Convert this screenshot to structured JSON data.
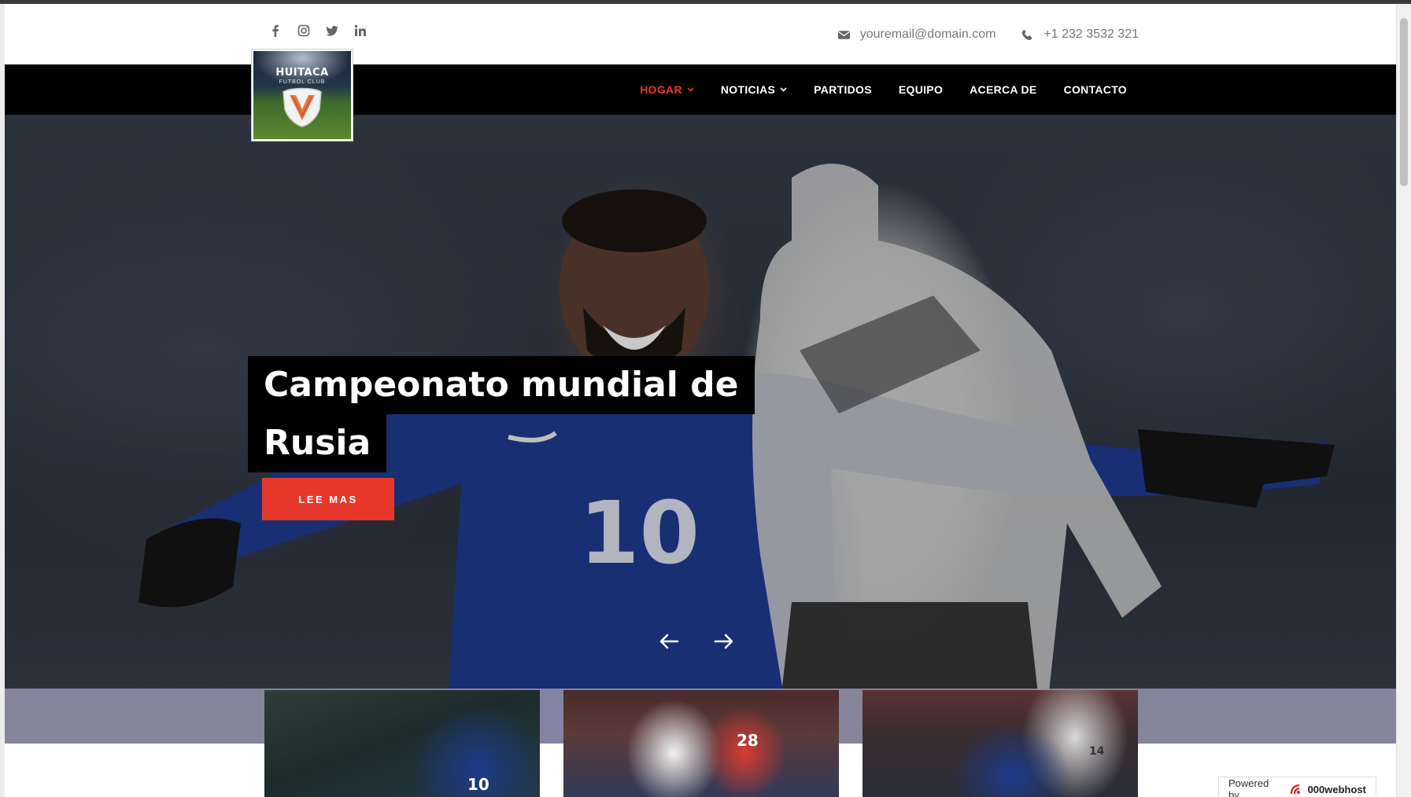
{
  "social": [
    {
      "icon": "facebook-icon"
    },
    {
      "icon": "instagram-icon"
    },
    {
      "icon": "twitter-icon"
    },
    {
      "icon": "linkedin-icon"
    }
  ],
  "contact": {
    "email": "youremail@domain.com",
    "phone": "+1 232 3532 321"
  },
  "logo": {
    "title": "HUITACA",
    "subtitle": "FUTBOL CLUB"
  },
  "nav": {
    "items": [
      {
        "label": "HOGAR",
        "dropdown": true,
        "active": true
      },
      {
        "label": "NOTICIAS",
        "dropdown": true,
        "active": false
      },
      {
        "label": "PARTIDOS",
        "dropdown": false,
        "active": false
      },
      {
        "label": "EQUIPO",
        "dropdown": false,
        "active": false
      },
      {
        "label": "ACERCA DE",
        "dropdown": false,
        "active": false
      },
      {
        "label": "CONTACTO",
        "dropdown": false,
        "active": false
      }
    ]
  },
  "hero": {
    "headline_line1": "Campeonato mundial de",
    "headline_line2": "Rusia",
    "cta_label": "LEE MAS",
    "jersey_number": "10"
  },
  "thumbnails": [
    {
      "jersey": "10"
    },
    {
      "jersey": "28"
    },
    {
      "jersey": "14"
    }
  ],
  "powered_by": {
    "prefix": "Powered by",
    "brand": "000webhost"
  },
  "colors": {
    "accent": "#e8382c",
    "nav_bg": "#000000",
    "text_muted": "#777777"
  }
}
